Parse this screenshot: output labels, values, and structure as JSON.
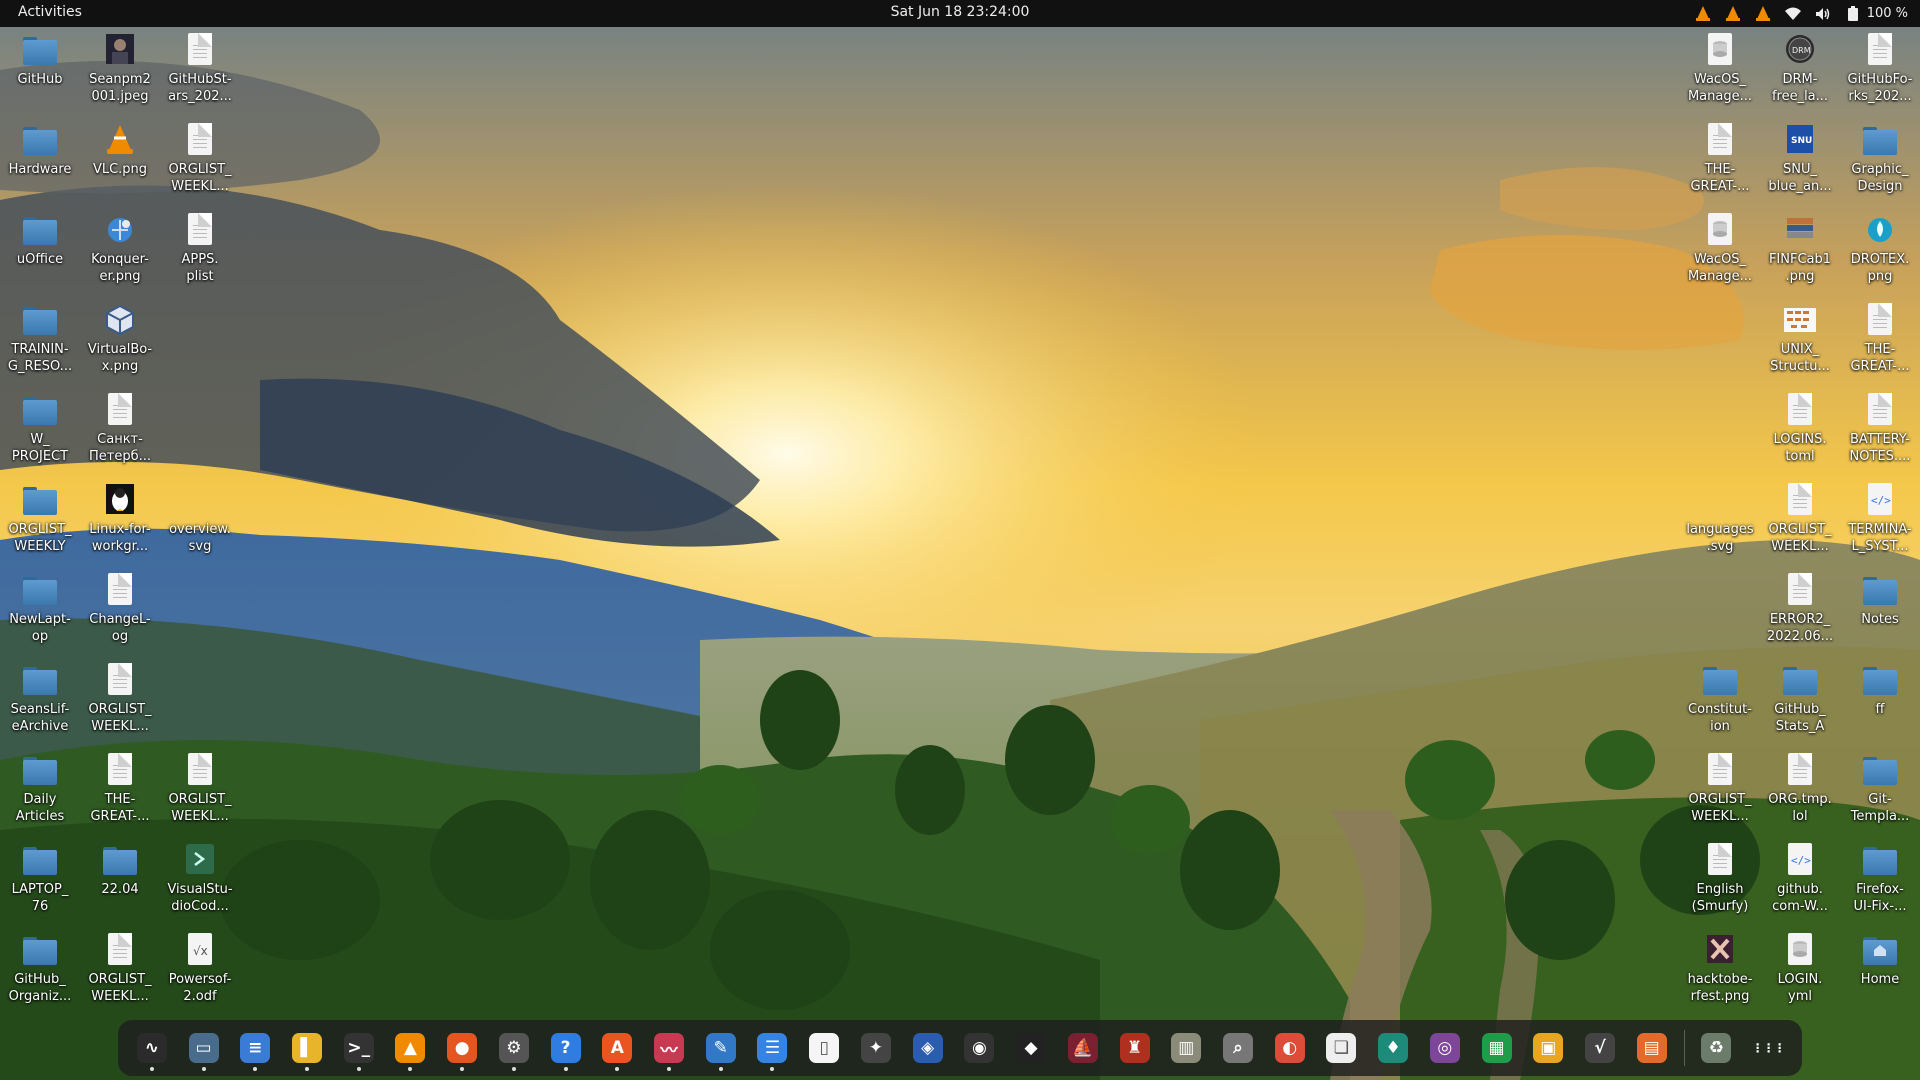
{
  "topbar": {
    "activities": "Activities",
    "datetime": "Sat Jun 18  23:24:00",
    "battery_percent": "100 %",
    "tray_icons": [
      "vlc-icon",
      "vlc-icon",
      "vlc-icon",
      "wifi-icon",
      "volume-icon",
      "battery-icon"
    ]
  },
  "desktop": {
    "left_col1": [
      {
        "label": "GitHub",
        "type": "folder"
      },
      {
        "label": "Hardware",
        "type": "folder"
      },
      {
        "label": "uOffice",
        "type": "folder"
      },
      {
        "label": "TRAININ-\nG_RESO...",
        "type": "folder"
      },
      {
        "label": "W_\nPROJECT",
        "type": "folder"
      },
      {
        "label": "ORGLIST_\nWEEKLY",
        "type": "folder"
      },
      {
        "label": "NewLapt-\nop",
        "type": "folder"
      },
      {
        "label": "SeansLif-\neArchive",
        "type": "folder"
      },
      {
        "label": "Daily\nArticles",
        "type": "folder"
      },
      {
        "label": "LAPTOP_\n76",
        "type": "folder"
      },
      {
        "label": "GitHub_\nOrganiz...",
        "type": "folder"
      }
    ],
    "left_col2": [
      {
        "label": "Seanpm2\n001.jpeg",
        "type": "photo"
      },
      {
        "label": "VLC.png",
        "type": "vlc"
      },
      {
        "label": "Konquer-\ner.png",
        "type": "konqueror"
      },
      {
        "label": "VirtualBo-\nx.png",
        "type": "virtualbox"
      },
      {
        "label": "Санкт-\nПетерб...",
        "type": "file"
      },
      {
        "label": "Linux-for-\nworkgr...",
        "type": "tux"
      },
      {
        "label": "ChangeL-\nog",
        "type": "file"
      },
      {
        "label": "ORGLIST_\nWEEKL...",
        "type": "file"
      },
      {
        "label": "THE-\nGREAT-...",
        "type": "file"
      },
      {
        "label": "22.04",
        "type": "folder"
      },
      {
        "label": "ORGLIST_\nWEEKL...",
        "type": "file"
      }
    ],
    "left_col3": [
      {
        "label": "GitHubSt-\nars_202...",
        "type": "file"
      },
      {
        "label": "ORGLIST_\nWEEKL...",
        "type": "file"
      },
      {
        "label": "APPS.\nplist",
        "type": "file"
      },
      {
        "label": "overview.\nsvg",
        "type": "none"
      },
      {
        "label": "ORGLIST_\nWEEKL...",
        "type": "file"
      },
      {
        "label": "VisualStu-\ndioCod...",
        "type": "vscode"
      },
      {
        "label": "Powersof-\n2.odf",
        "type": "formula"
      }
    ],
    "right_col1": [
      {
        "label": "WacOS_\nManage...",
        "type": "db"
      },
      {
        "label": "THE-\nGREAT-...",
        "type": "file"
      },
      {
        "label": "WacOS_\nManage...",
        "type": "db"
      },
      {
        "label": "languages\n.svg",
        "type": "none"
      },
      {
        "label": "Constitut-\nion",
        "type": "folder"
      },
      {
        "label": "ORGLIST_\nWEEKL...",
        "type": "file"
      },
      {
        "label": "English\n(Smurfy)",
        "type": "file"
      },
      {
        "label": "hacktobe-\nrfest.png",
        "type": "hacktober"
      }
    ],
    "right_col2": [
      {
        "label": "DRM-\nfree_la...",
        "type": "drm"
      },
      {
        "label": "SNU_\nblue_an...",
        "type": "snu"
      },
      {
        "label": "FINFCab1\n.png",
        "type": "finf"
      },
      {
        "label": "UNIX_\nStructu...",
        "type": "unix"
      },
      {
        "label": "LOGINS.\ntoml",
        "type": "file"
      },
      {
        "label": "ORGLIST_\nWEEKL...",
        "type": "file"
      },
      {
        "label": "ERROR2_\n2022.06...",
        "type": "file"
      },
      {
        "label": "GitHub_\nStats_A",
        "type": "folder"
      },
      {
        "label": "ORG.tmp.\nlol",
        "type": "file"
      },
      {
        "label": "github.\ncom-W...",
        "type": "code"
      },
      {
        "label": "LOGIN.\nyml",
        "type": "db"
      }
    ],
    "right_col3": [
      {
        "label": "GitHubFo-\nrks_202...",
        "type": "file"
      },
      {
        "label": "Graphic_\nDesign",
        "type": "folder"
      },
      {
        "label": "DROTEX.\npng",
        "type": "drop"
      },
      {
        "label": "THE-\nGREAT-...",
        "type": "file"
      },
      {
        "label": "BATTERY-\nNOTES....",
        "type": "file"
      },
      {
        "label": "TERMINA-\nL_SYST...",
        "type": "code"
      },
      {
        "label": "Notes",
        "type": "folder"
      },
      {
        "label": "ff",
        "type": "folder"
      },
      {
        "label": "Git-\nTempla...",
        "type": "folder"
      },
      {
        "label": "Firefox-\nUI-Fix-...",
        "type": "folder"
      },
      {
        "label": "Home",
        "type": "home"
      }
    ]
  },
  "dock": {
    "items": [
      {
        "name": "system-monitor",
        "glyph": "∿",
        "color": "#2b2b2b",
        "running": true
      },
      {
        "name": "files",
        "glyph": "▭",
        "color": "#4a6c8c",
        "running": true
      },
      {
        "name": "text-editor",
        "glyph": "≡",
        "color": "#3a7bd5",
        "running": true
      },
      {
        "name": "notes",
        "glyph": "▌",
        "color": "#e8b52a",
        "running": true
      },
      {
        "name": "terminal",
        "glyph": ">_",
        "color": "#333",
        "running": true
      },
      {
        "name": "vlc",
        "glyph": "▲",
        "color": "#f08a00",
        "running": true
      },
      {
        "name": "firefox",
        "glyph": "●",
        "color": "#e5551f",
        "running": true
      },
      {
        "name": "settings",
        "glyph": "⚙",
        "color": "#555",
        "running": true
      },
      {
        "name": "help",
        "glyph": "?",
        "color": "#2f7de1",
        "running": true
      },
      {
        "name": "software",
        "glyph": "A",
        "color": "#e95420",
        "running": true
      },
      {
        "name": "activity",
        "glyph": "〰",
        "color": "#c83a52",
        "running": true
      },
      {
        "name": "writer",
        "glyph": "✎",
        "color": "#3178c6",
        "running": true
      },
      {
        "name": "tweaks",
        "glyph": "☰",
        "color": "#3584e4",
        "running": true
      },
      {
        "name": "document",
        "glyph": "▯",
        "color": "#f5f5f5",
        "running": false
      },
      {
        "name": "telescope",
        "glyph": "✦",
        "color": "#444",
        "running": false
      },
      {
        "name": "virtualbox",
        "glyph": "◈",
        "color": "#2a5db0",
        "running": false
      },
      {
        "name": "camera",
        "glyph": "◉",
        "color": "#333",
        "running": false
      },
      {
        "name": "inkscape",
        "glyph": "◆",
        "color": "#222",
        "running": false
      },
      {
        "name": "game-ship",
        "glyph": "⛵",
        "color": "#7a2030",
        "running": false
      },
      {
        "name": "game-mario",
        "glyph": "♜",
        "color": "#b03020",
        "running": false
      },
      {
        "name": "archive",
        "glyph": "▥",
        "color": "#8b8b7a",
        "running": false
      },
      {
        "name": "image-viewer",
        "glyph": "⌕",
        "color": "#777",
        "running": false
      },
      {
        "name": "chrome",
        "glyph": "◐",
        "color": "#dd4b39",
        "running": false
      },
      {
        "name": "app-book",
        "glyph": "❏",
        "color": "#eee",
        "running": false
      },
      {
        "name": "app-green",
        "glyph": "♦",
        "color": "#1e8a7a",
        "running": false
      },
      {
        "name": "tor",
        "glyph": "◎",
        "color": "#7d4698",
        "running": false
      },
      {
        "name": "calc",
        "glyph": "▦",
        "color": "#1e9c4a",
        "running": false
      },
      {
        "name": "impress",
        "glyph": "▣",
        "color": "#e8a623",
        "running": false
      },
      {
        "name": "math",
        "glyph": "√",
        "color": "#444",
        "running": false
      },
      {
        "name": "draw",
        "glyph": "▤",
        "color": "#e26b2c",
        "running": false
      },
      {
        "name": "trash",
        "glyph": "♻",
        "color": "#6b7c6b",
        "running": false
      },
      {
        "name": "show-apps",
        "glyph": "⋮⋮⋮",
        "color": "transparent",
        "running": false
      }
    ]
  }
}
